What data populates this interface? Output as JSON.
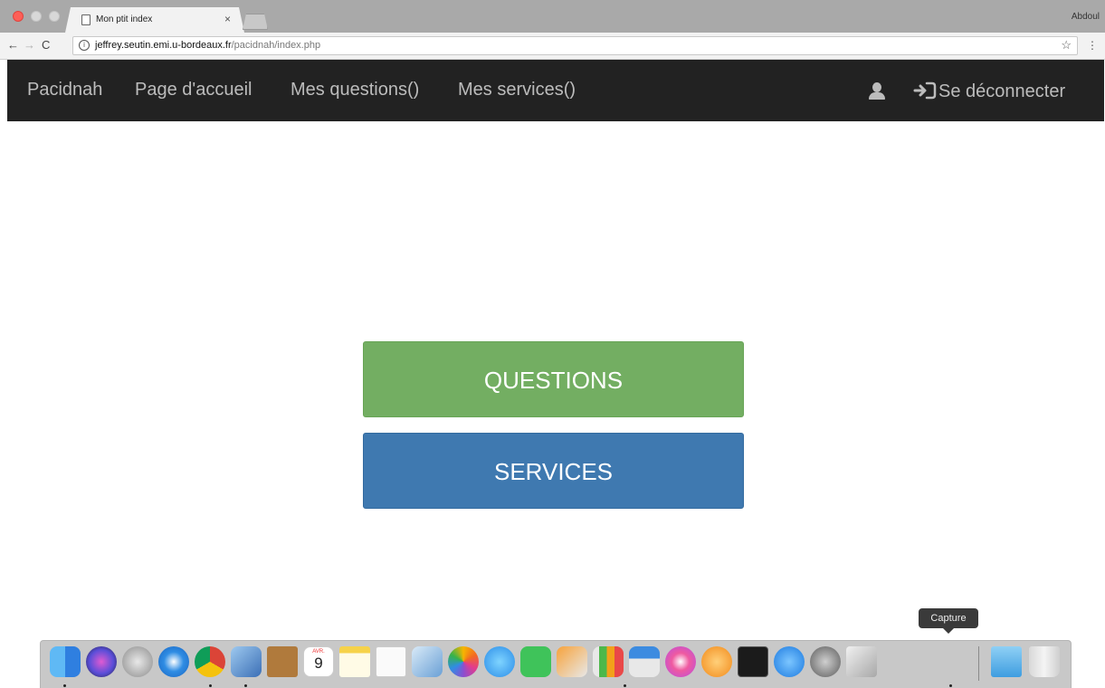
{
  "browser": {
    "tab_title": "Mon ptit index",
    "tab_close": "×",
    "profile_name": "Abdoul",
    "url_host": "jeffrey.seutin.emi.u-bordeaux.fr",
    "url_path": "/pacidnah/index.php",
    "nav": {
      "back": "←",
      "forward": "→",
      "reload": "C"
    },
    "info_glyph": "i",
    "star_glyph": "☆",
    "menu_glyph": "⋮"
  },
  "navbar": {
    "brand": "Pacidnah",
    "links": [
      "Page d'accueil",
      "Mes questions()",
      "Mes services()"
    ],
    "logout_label": "Se déconnecter",
    "icons": [
      "user-icon",
      "sign-in-icon"
    ]
  },
  "main": {
    "questions_label": "QUESTIONS",
    "services_label": "SERVICES",
    "colors": {
      "questions": "#73ae62",
      "services": "#3f79b0",
      "navbar": "#222222"
    }
  },
  "dock": {
    "tooltip": "Capture",
    "calendar_month": "AVR.",
    "calendar_day": "9",
    "apps": [
      "finder-icon",
      "siri-icon",
      "launchpad-icon",
      "safari-icon",
      "chrome-icon",
      "preview-icon",
      "contacts-icon",
      "calendar-icon",
      "notes-icon",
      "reminders-icon",
      "photo-booth-icon",
      "photos-icon",
      "messages-icon",
      "facetime-icon",
      "pages-icon",
      "numbers-icon",
      "keynote-icon",
      "itunes-icon",
      "ibooks-icon",
      "terminal-icon",
      "app-store-icon",
      "system-preferences-icon",
      "capture-icon",
      "downloads-folder-icon",
      "trash-icon"
    ]
  }
}
